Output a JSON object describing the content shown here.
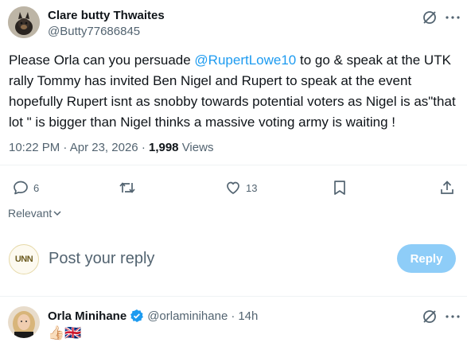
{
  "tweet": {
    "author_name": "Clare butty Thwaites",
    "author_handle": "@Butty77686845",
    "text_before": "Please Orla can you persuade ",
    "mention": "@RupertLowe10",
    "text_after": " to go & speak at the UTK rally Tommy has invited Ben Nigel and Rupert to speak at the event hopefully Rupert isnt as snobby towards potential voters as Nigel is as\"that lot \" is bigger than Nigel thinks a massive voting army is waiting !",
    "time": "10:22 PM",
    "date": "Apr 23, 2026",
    "views_count": "1,998",
    "views_label": "Views"
  },
  "actions": {
    "replies": "6",
    "likes": "13"
  },
  "sort": {
    "label": "Relevant"
  },
  "composer": {
    "placeholder": "Post your reply",
    "button": "Reply",
    "avatar_text": "UNN"
  },
  "reply": {
    "author_name": "Orla Minihane",
    "author_handle": "@orlaminihane",
    "time": "14h",
    "text": "👍🏻🇬🇧"
  },
  "colors": {
    "accent": "#1d9bf0",
    "muted": "#536471",
    "reply_button": "#8ecdf8",
    "verified": "#1d9bf0"
  }
}
